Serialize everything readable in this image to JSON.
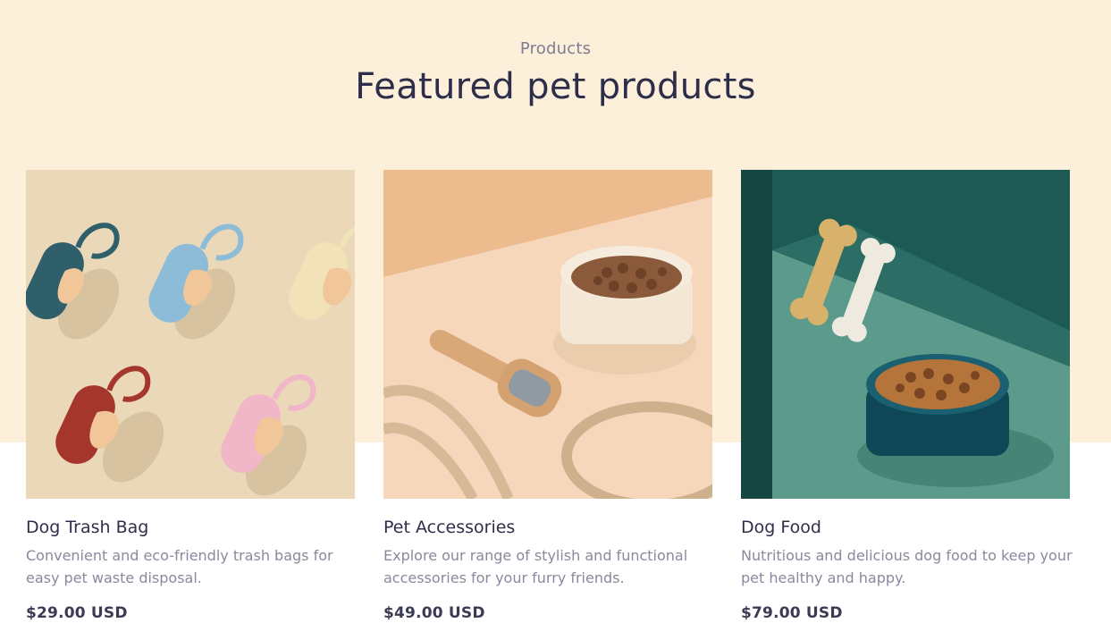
{
  "section": {
    "eyebrow": "Products",
    "title": "Featured pet products"
  },
  "products": [
    {
      "title": "Dog Trash Bag",
      "description": "Convenient and eco-friendly trash bags for easy pet waste disposal.",
      "price": "$29.00 USD",
      "image_icon": "poop-bag-dispenser-photo"
    },
    {
      "title": "Pet Accessories",
      "description": "Explore our range of stylish and functional accessories for your furry friends.",
      "price": "$49.00 USD",
      "image_icon": "pet-bowl-brush-leash-photo"
    },
    {
      "title": "Dog Food",
      "description": "Nutritious and delicious dog food to keep your pet healthy and happy.",
      "price": "$79.00 USD",
      "image_icon": "dog-food-bowl-bones-photo"
    }
  ],
  "colors": {
    "hero_background": "#fdf0da",
    "heading": "#2f2e4a",
    "muted_text": "#8a899d"
  }
}
